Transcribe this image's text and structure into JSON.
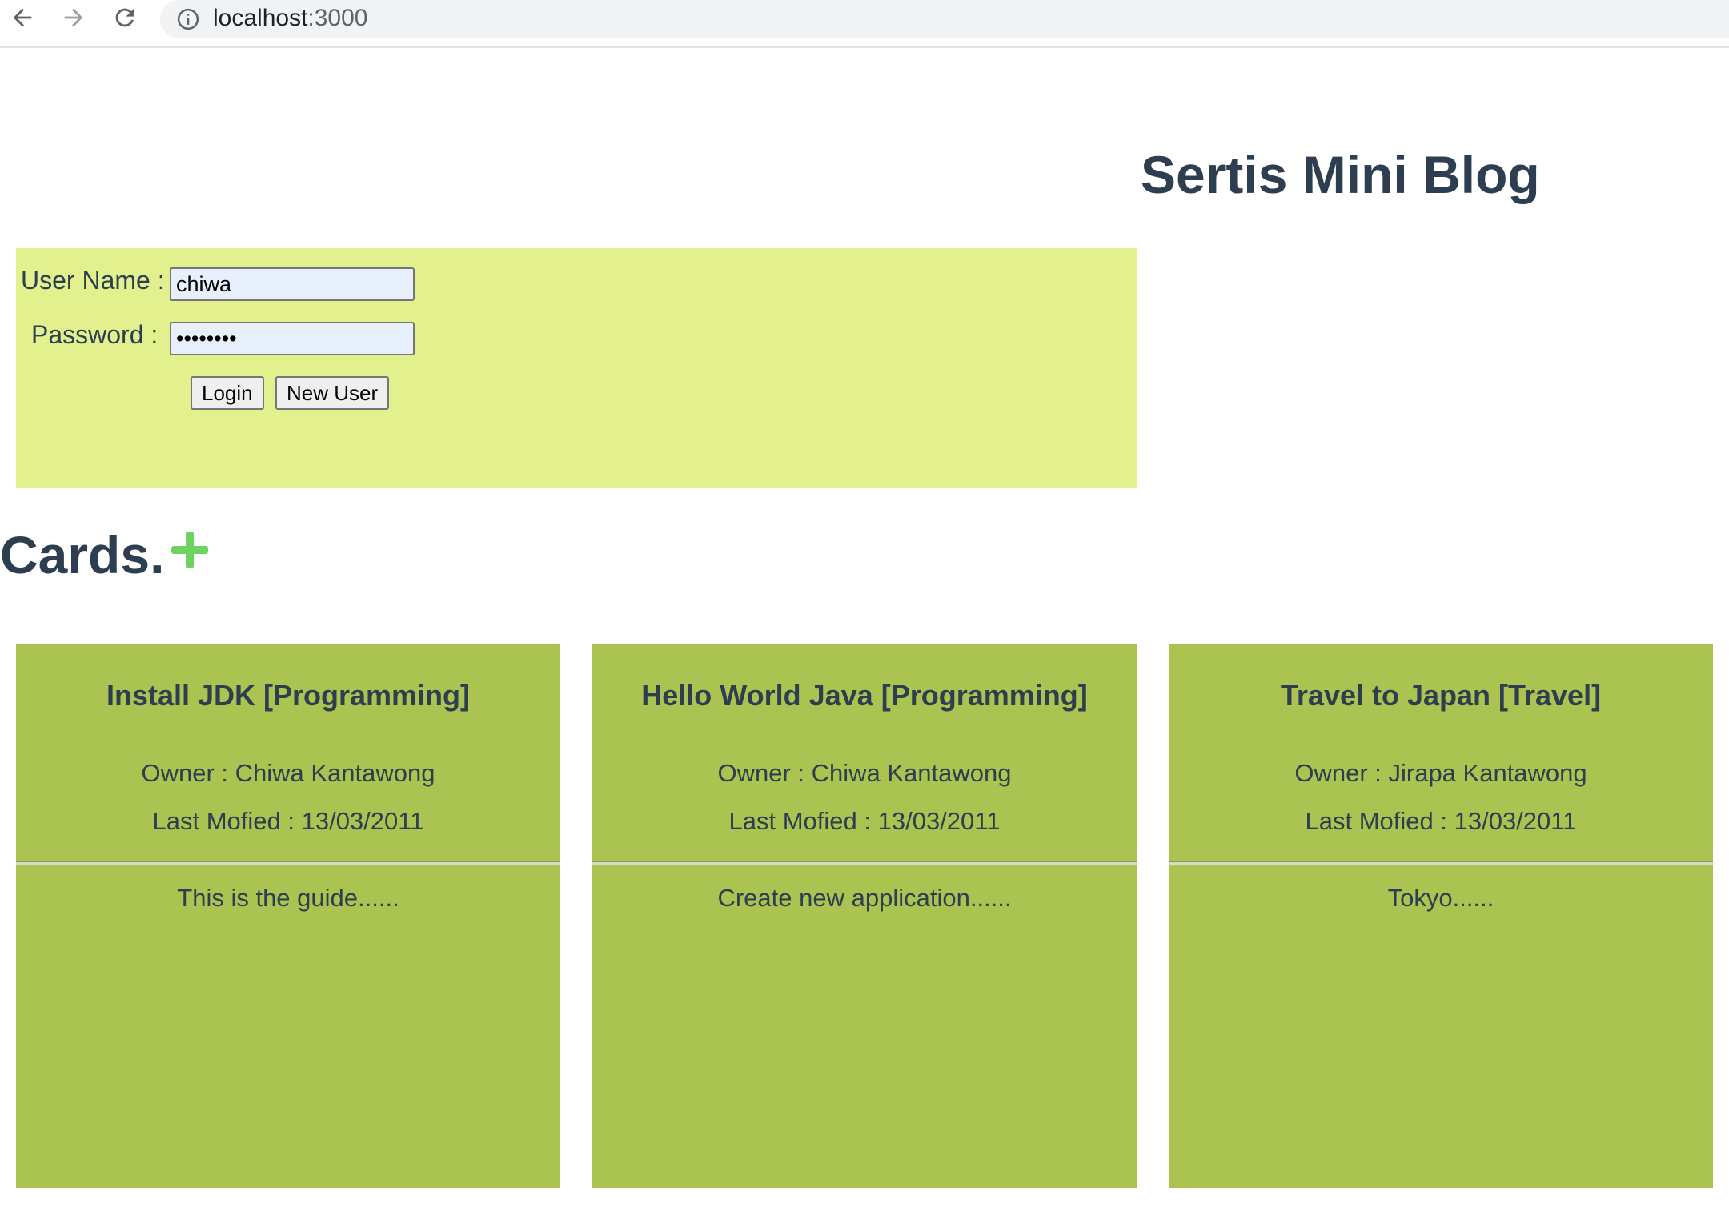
{
  "browser": {
    "url_host": "localhost",
    "url_port": ":3000"
  },
  "header": {
    "title": "Sertis Mini Blog"
  },
  "login": {
    "username_label": "User Name :",
    "username_value": "chiwa",
    "password_label": "Password :",
    "password_value": "password",
    "login_button": "Login",
    "new_user_button": "New User"
  },
  "cards_section": {
    "heading": "Cards."
  },
  "cards": [
    {
      "title": "Install JDK [Programming]",
      "owner": "Owner : Chiwa Kantawong",
      "modified": "Last Mofied : 13/03/2011",
      "body": "This is the guide......"
    },
    {
      "title": "Hello World Java [Programming]",
      "owner": "Owner : Chiwa Kantawong",
      "modified": "Last Mofied : 13/03/2011",
      "body": "Create new application......"
    },
    {
      "title": "Travel to Japan [Travel]",
      "owner": "Owner : Jirapa Kantawong",
      "modified": "Last Mofied : 13/03/2011",
      "body": "Tokyo......"
    }
  ],
  "colors": {
    "login_panel_bg": "#e2f08e",
    "card_bg": "#abc451",
    "heading_text": "#2c3e50",
    "add_icon": "#6cd35e"
  }
}
